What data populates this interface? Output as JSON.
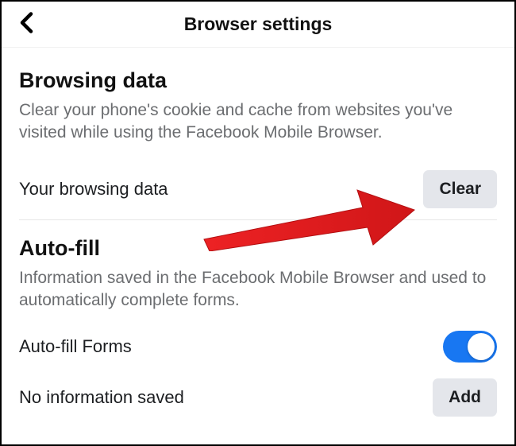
{
  "header": {
    "title": "Browser settings"
  },
  "browsing_data": {
    "title": "Browsing data",
    "description": "Clear your phone's cookie and cache from websites you've visited while using the Facebook Mobile Browser.",
    "row_label": "Your browsing data",
    "clear_label": "Clear"
  },
  "autofill": {
    "title": "Auto-fill",
    "description": "Information saved in the Facebook Mobile Browser and used to automatically complete forms.",
    "forms_label": "Auto-fill Forms",
    "forms_on": true,
    "no_info_label": "No information saved",
    "add_label": "Add"
  },
  "colors": {
    "arrow": "#ed2224",
    "toggle_on": "#1877f2"
  }
}
